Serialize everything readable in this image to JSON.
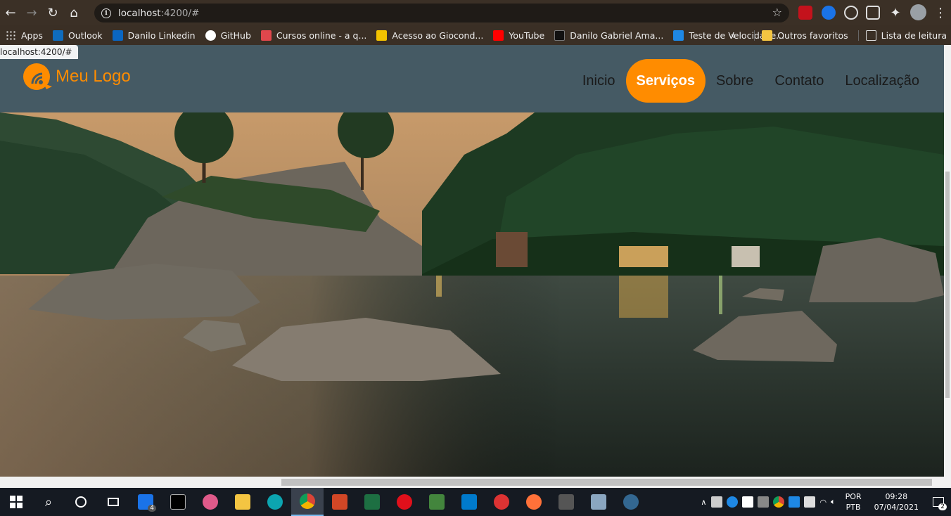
{
  "browser": {
    "url_host": "localhost",
    "url_path": ":4200/#",
    "status_url": "localhost:4200/#"
  },
  "bookmarks": {
    "items": [
      {
        "label": "Apps",
        "icon": "apps-grid-icon",
        "color": "#e8e8e8"
      },
      {
        "label": "Outlook",
        "icon": "outlook-icon",
        "color": "#0f6cbd"
      },
      {
        "label": "Danilo Linkedin",
        "icon": "linkedin-icon",
        "color": "#0a66c2"
      },
      {
        "label": "GitHub",
        "icon": "github-icon",
        "color": "#ffffff"
      },
      {
        "label": "Cursos online - a q...",
        "icon": "udemy-icon",
        "color": "#e0474c"
      },
      {
        "label": "Acesso ao Giocond...",
        "icon": "giocond-icon",
        "color": "#f2c200"
      },
      {
        "label": "YouTube",
        "icon": "youtube-icon",
        "color": "#ff0000"
      },
      {
        "label": "Danilo Gabriel Ama...",
        "icon": "bookmark-site-icon",
        "color": "#111111"
      },
      {
        "label": "Teste de Velocidade...",
        "icon": "speedtest-icon",
        "color": "#1e88e5"
      }
    ],
    "overflow": "»",
    "other_favorites": "Outros favoritos",
    "reading_list": "Lista de leitura"
  },
  "site": {
    "logo_text": "Meu Logo",
    "accent": "#ff8c00",
    "header_bg": "#455a64",
    "nav": [
      {
        "label": "Inicio",
        "active": false
      },
      {
        "label": "Serviços",
        "active": true
      },
      {
        "label": "Sobre",
        "active": false
      },
      {
        "label": "Contato",
        "active": false
      },
      {
        "label": "Localização",
        "active": false
      }
    ]
  },
  "taskbar": {
    "mail_badge": "4",
    "lang_top": "POR",
    "lang_bottom": "PTB",
    "time": "09:28",
    "date": "07/04/2021",
    "notifications": "2"
  }
}
